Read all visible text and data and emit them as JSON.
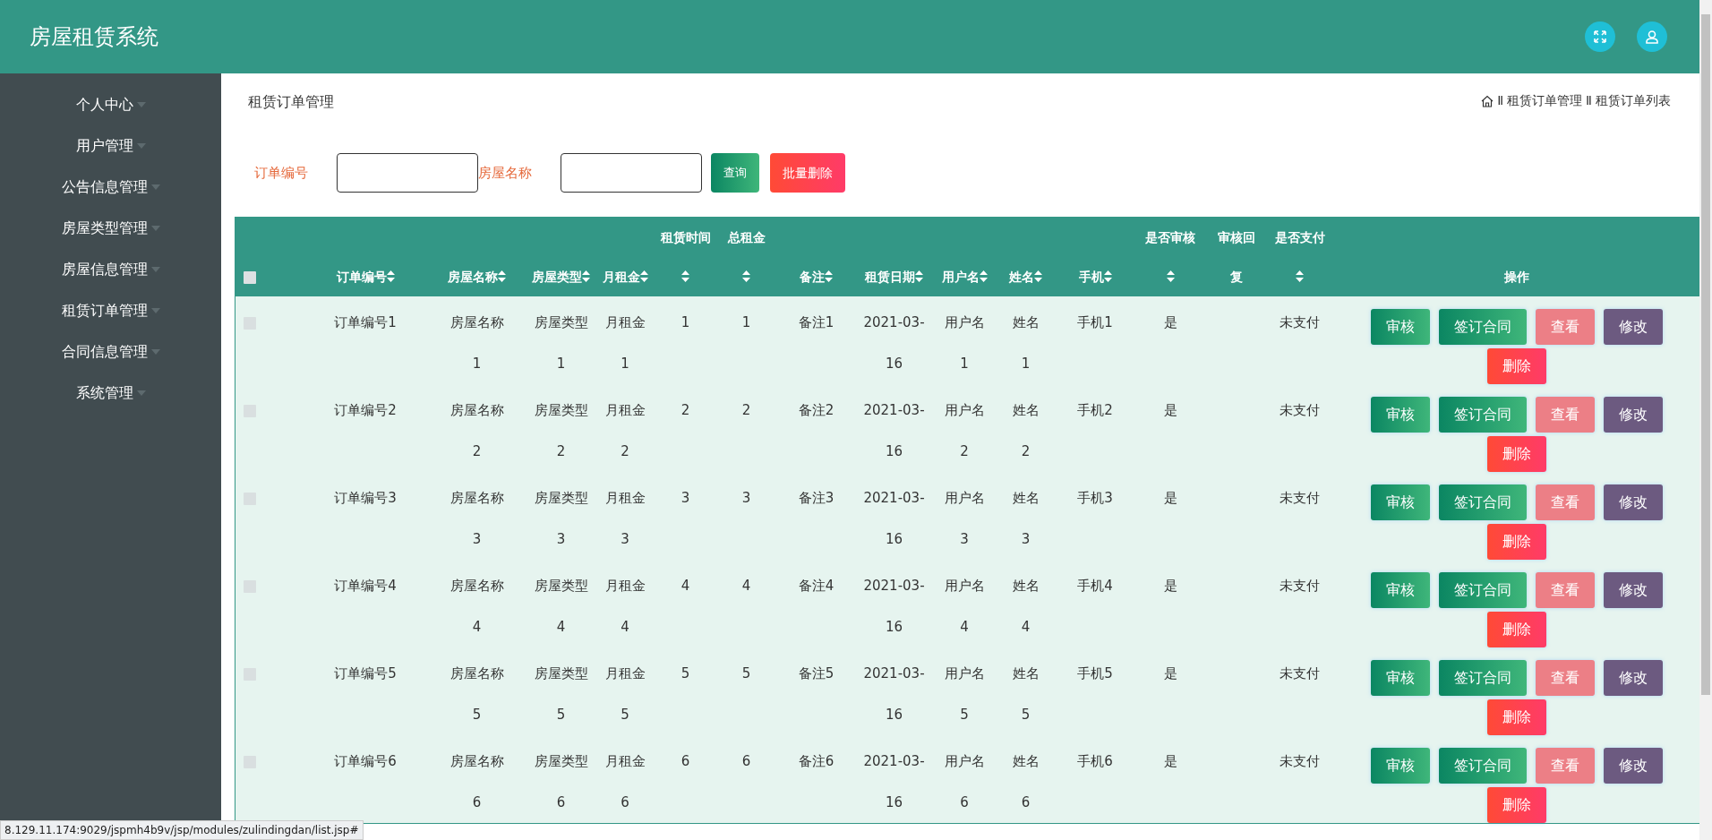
{
  "app_title": "房屋租赁系统",
  "sidebar": {
    "items": [
      {
        "label": "个人中心"
      },
      {
        "label": "用户管理"
      },
      {
        "label": "公告信息管理"
      },
      {
        "label": "房屋类型管理"
      },
      {
        "label": "房屋信息管理"
      },
      {
        "label": "租赁订单管理"
      },
      {
        "label": "合同信息管理"
      },
      {
        "label": "系统管理"
      }
    ]
  },
  "page_title": "租赁订单管理",
  "breadcrumb": [
    {
      "separator": "Ⅱ",
      "label": "租赁订单管理"
    },
    {
      "separator": "Ⅱ",
      "label": "租赁订单列表"
    }
  ],
  "search": {
    "fields": [
      {
        "label": "订单编号"
      },
      {
        "label": "房屋名称"
      }
    ],
    "buttons": [
      {
        "label": "查询",
        "kind": "query"
      },
      {
        "label": "批量删除",
        "kind": "batch-delete"
      }
    ]
  },
  "table": {
    "select_all": {
      "checked": false
    },
    "columns": [
      {
        "label": "订单编号",
        "sortable": true
      },
      {
        "label": "房屋名称",
        "sortable": true
      },
      {
        "label": "房屋类型",
        "sortable": true
      },
      {
        "label": "月租金",
        "sortable": true
      },
      {
        "label": "租赁时间",
        "sortable": true
      },
      {
        "label": "总租金",
        "sortable": true
      },
      {
        "label": "备注",
        "sortable": true
      },
      {
        "label": "租赁日期",
        "sortable": true
      },
      {
        "label": "用户名",
        "sortable": true
      },
      {
        "label": "姓名",
        "sortable": true
      },
      {
        "label": "手机",
        "sortable": true
      },
      {
        "label": "是否审核",
        "sortable": true
      },
      {
        "label": "审核回复",
        "sortable": false
      },
      {
        "label": "是否支付",
        "sortable": true
      },
      {
        "label": "操作",
        "sortable": false
      }
    ],
    "rows": [
      {
        "checked": false,
        "cells": [
          "订单编号1",
          "房屋名称1",
          "房屋类型1",
          "月租金1",
          "1",
          "1",
          "备注1",
          "2021-03-16",
          "用户名1",
          "姓名1",
          "手机1",
          "是",
          "",
          "未支付"
        ],
        "actions": [
          {
            "label": "审核",
            "kind": "review"
          },
          {
            "label": "签订合同",
            "kind": "contract"
          },
          {
            "label": "查看",
            "kind": "view"
          },
          {
            "label": "修改",
            "kind": "edit"
          },
          {
            "label": "删除",
            "kind": "delete"
          }
        ]
      },
      {
        "checked": false,
        "cells": [
          "订单编号2",
          "房屋名称2",
          "房屋类型2",
          "月租金2",
          "2",
          "2",
          "备注2",
          "2021-03-16",
          "用户名2",
          "姓名2",
          "手机2",
          "是",
          "",
          "未支付"
        ],
        "actions": [
          {
            "label": "审核",
            "kind": "review"
          },
          {
            "label": "签订合同",
            "kind": "contract"
          },
          {
            "label": "查看",
            "kind": "view"
          },
          {
            "label": "修改",
            "kind": "edit"
          },
          {
            "label": "删除",
            "kind": "delete"
          }
        ]
      },
      {
        "checked": false,
        "cells": [
          "订单编号3",
          "房屋名称3",
          "房屋类型3",
          "月租金3",
          "3",
          "3",
          "备注3",
          "2021-03-16",
          "用户名3",
          "姓名3",
          "手机3",
          "是",
          "",
          "未支付"
        ],
        "actions": [
          {
            "label": "审核",
            "kind": "review"
          },
          {
            "label": "签订合同",
            "kind": "contract"
          },
          {
            "label": "查看",
            "kind": "view"
          },
          {
            "label": "修改",
            "kind": "edit"
          },
          {
            "label": "删除",
            "kind": "delete"
          }
        ]
      },
      {
        "checked": false,
        "cells": [
          "订单编号4",
          "房屋名称4",
          "房屋类型4",
          "月租金4",
          "4",
          "4",
          "备注4",
          "2021-03-16",
          "用户名4",
          "姓名4",
          "手机4",
          "是",
          "",
          "未支付"
        ],
        "actions": [
          {
            "label": "审核",
            "kind": "review"
          },
          {
            "label": "签订合同",
            "kind": "contract"
          },
          {
            "label": "查看",
            "kind": "view"
          },
          {
            "label": "修改",
            "kind": "edit"
          },
          {
            "label": "删除",
            "kind": "delete"
          }
        ]
      },
      {
        "checked": false,
        "cells": [
          "订单编号5",
          "房屋名称5",
          "房屋类型5",
          "月租金5",
          "5",
          "5",
          "备注5",
          "2021-03-16",
          "用户名5",
          "姓名5",
          "手机5",
          "是",
          "",
          "未支付"
        ],
        "actions": [
          {
            "label": "审核",
            "kind": "review"
          },
          {
            "label": "签订合同",
            "kind": "contract"
          },
          {
            "label": "查看",
            "kind": "view"
          },
          {
            "label": "修改",
            "kind": "edit"
          },
          {
            "label": "删除",
            "kind": "delete"
          }
        ]
      },
      {
        "checked": false,
        "cells": [
          "订单编号6",
          "房屋名称6",
          "房屋类型6",
          "月租金6",
          "6",
          "6",
          "备注6",
          "2021-03-16",
          "用户名6",
          "姓名6",
          "手机6",
          "是",
          "",
          "未支付"
        ],
        "actions": [
          {
            "label": "审核",
            "kind": "review"
          },
          {
            "label": "签订合同",
            "kind": "contract"
          },
          {
            "label": "查看",
            "kind": "view"
          },
          {
            "label": "修改",
            "kind": "edit"
          },
          {
            "label": "删除",
            "kind": "delete"
          }
        ]
      }
    ]
  },
  "status_bar": "8.129.11.174:9029/jspmh4b9v/jsp/modules/zulindingdan/list.jsp#"
}
